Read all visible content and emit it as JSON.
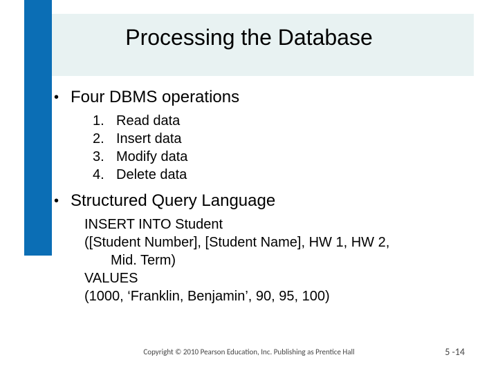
{
  "title": "Processing the Database",
  "bullets": [
    {
      "text": "Four DBMS operations"
    },
    {
      "text": "Structured Query Language"
    }
  ],
  "dbms_ops": [
    {
      "num": "1.",
      "text": "Read data"
    },
    {
      "num": "2.",
      "text": "Insert data"
    },
    {
      "num": "3.",
      "text": "Modify data"
    },
    {
      "num": "4.",
      "text": "Delete data"
    }
  ],
  "sql": {
    "line1": "INSERT INTO Student",
    "line2": "([Student Number], [Student Name], HW 1, HW 2,",
    "line3": "Mid. Term)",
    "line4": "VALUES",
    "line5": "(1000, ‘Franklin, Benjamin’,  90, 95, 100)"
  },
  "footer": "Copyright © 2010 Pearson Education, Inc. Publishing as Prentice Hall",
  "page": "5 -14",
  "glyphs": {
    "bullet": "•"
  }
}
